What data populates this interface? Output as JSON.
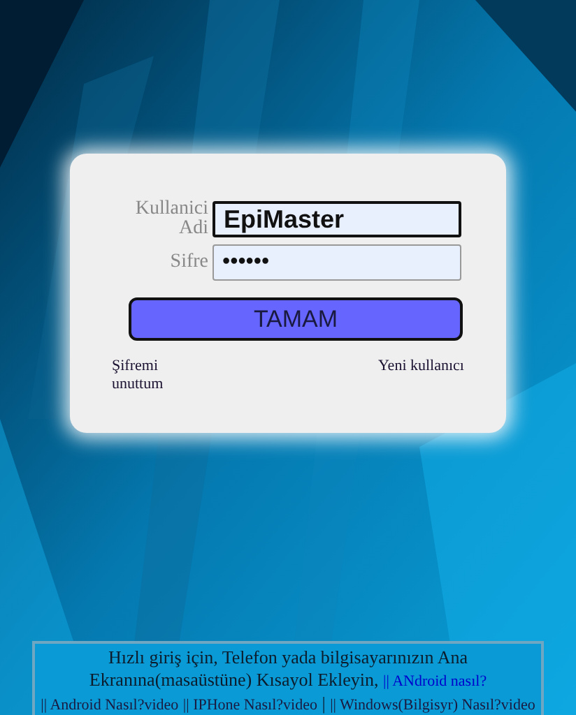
{
  "login": {
    "fields": [
      {
        "label": "Kullanici Adi",
        "kind": "text",
        "value": "EpiMaster",
        "focused": true
      },
      {
        "label": "Sifre",
        "kind": "password",
        "value": "••••••",
        "focused": false
      }
    ],
    "submit": "TAMAM",
    "forgot": "Şifremi unuttum",
    "register": "Yeni kullanıcı"
  },
  "notice": {
    "parts": [
      {
        "kind": "text",
        "text": "Hızlı giriş için, Telefon yada bilgisayarınızın Ana Ekranına(masaüstüne) Kısayol Ekleyin,"
      },
      {
        "kind": "link",
        "text": "|| ANdroid nasıl?",
        "color": "#0000cc"
      },
      {
        "kind": "link",
        "text": "|| Android Nasıl?video",
        "color": "#1a1a40"
      },
      {
        "kind": "link",
        "text": "|| IPHone Nasıl?video",
        "color": "#1a1a40"
      },
      {
        "kind": "sep",
        "text": "|"
      },
      {
        "kind": "link",
        "text": "|| Windows(Bilgisyr) Nasıl?video",
        "color": "#1a1a40"
      }
    ]
  }
}
